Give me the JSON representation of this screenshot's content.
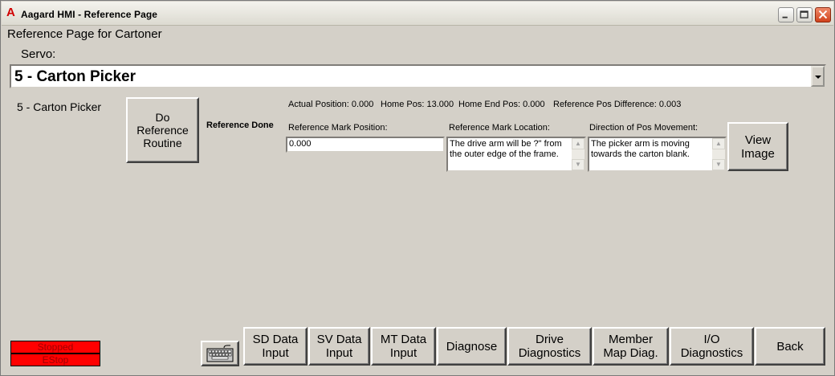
{
  "window": {
    "app_icon": "A",
    "title": "Aagard HMI - Reference Page",
    "controls": [
      "minimize-icon",
      "maximize-icon",
      "close-icon"
    ]
  },
  "page": {
    "heading": "Reference Page for Cartoner",
    "servo_label": "Servo:",
    "servo_selected": "5 - Carton Picker",
    "servo_name": "5 - Carton Picker"
  },
  "reference": {
    "do_button_line1": "Do",
    "do_button_line2": "Reference",
    "do_button_line3": "Routine",
    "status": "Reference Done",
    "actual_position": "Actual Position: 0.000",
    "home_pos": "Home Pos: 13.000",
    "home_end_pos": "Home End Pos: 0.000",
    "ref_pos_diff": "Reference Pos Difference: 0.003",
    "mark_position_label": "Reference Mark Position:",
    "mark_position_value": "0.000",
    "mark_location_label": "Reference Mark Location:",
    "mark_location_value": "The drive arm will be ?\" from the outer edge of the frame.",
    "direction_label": "Direction of Pos Movement:",
    "direction_value": "The picker arm is moving towards the carton blank.",
    "view_button_line1": "View",
    "view_button_line2": "Image"
  },
  "status": {
    "stopped": "Stopped",
    "estop": "EStop",
    "color": "#ff0000"
  },
  "nav": [
    {
      "line1": "SD Data",
      "line2": "Input"
    },
    {
      "line1": "SV Data",
      "line2": "Input"
    },
    {
      "line1": "MT Data",
      "line2": "Input"
    },
    {
      "line1": "Diagnose",
      "line2": ""
    },
    {
      "line1": "Drive",
      "line2": "Diagnostics"
    },
    {
      "line1": "Member",
      "line2": "Map Diag."
    },
    {
      "line1": "I/O",
      "line2": "Diagnostics"
    },
    {
      "line1": "Back",
      "line2": ""
    }
  ],
  "keyboard_icon": "keyboard-icon"
}
